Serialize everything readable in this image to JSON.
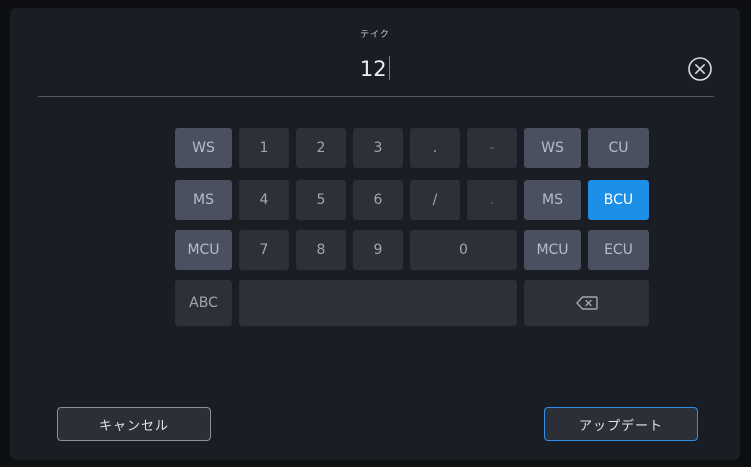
{
  "field": {
    "label": "テイク",
    "value": "12"
  },
  "keys": {
    "ws_left": "WS",
    "ms_left": "MS",
    "mcu_left": "MCU",
    "abc": "ABC",
    "n1": "1",
    "n2": "2",
    "n3": "3",
    "n4": "4",
    "n5": "5",
    "n6": "6",
    "n7": "7",
    "n8": "8",
    "n9": "9",
    "n0": "0",
    "dot": ".",
    "dash": "-",
    "slash": "/",
    "dot2": ".",
    "ws_right": "WS",
    "cu": "CU",
    "ms_right": "MS",
    "bcu": "BCU",
    "mcu_right": "MCU",
    "ecu": "ECU"
  },
  "footer": {
    "cancel_label": "キャンセル",
    "update_label": "アップデート"
  },
  "colors": {
    "accent": "#1e8fe6",
    "background": "#1a1d23"
  },
  "icons": {
    "clear": "circle-x-icon",
    "backspace": "backspace-icon"
  }
}
